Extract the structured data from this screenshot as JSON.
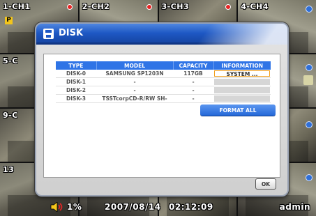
{
  "cameras": [
    "1-CH1",
    "2-CH2",
    "3-CH3",
    "4-CH4",
    "5-C",
    "9-C",
    "13"
  ],
  "p_badge": "P",
  "dialog": {
    "title": "DISK",
    "columns": [
      "TYPE",
      "MODEL",
      "CAPACITY",
      "INFORMATION"
    ],
    "rows": [
      {
        "type": "DISK-0",
        "model": "SAMSUNG SP1203N",
        "capacity": "117GB",
        "info": "SYSTEM ..."
      },
      {
        "type": "DISK-1",
        "model": "-",
        "capacity": "-",
        "info": ""
      },
      {
        "type": "DISK-2",
        "model": "-",
        "capacity": "-",
        "info": ""
      },
      {
        "type": "DISK-3",
        "model": "TSSTcorpCD-R/RW SH-",
        "capacity": "-",
        "info": ""
      }
    ],
    "format_all_label": "FORMAT ALL",
    "ok_label": "OK"
  },
  "status": {
    "volume": "1%",
    "date": "2007/08/14",
    "time": "02:12:09",
    "user": "admin"
  },
  "colors": {
    "header_blue": "#1e58c4",
    "table_header": "#2f74e6",
    "record_dot": "#e82323",
    "selected_outline": "#f0a020"
  },
  "icons": {
    "dialog": "disk-icon",
    "volume": "speaker-icon",
    "record": "record-dot-icon"
  }
}
